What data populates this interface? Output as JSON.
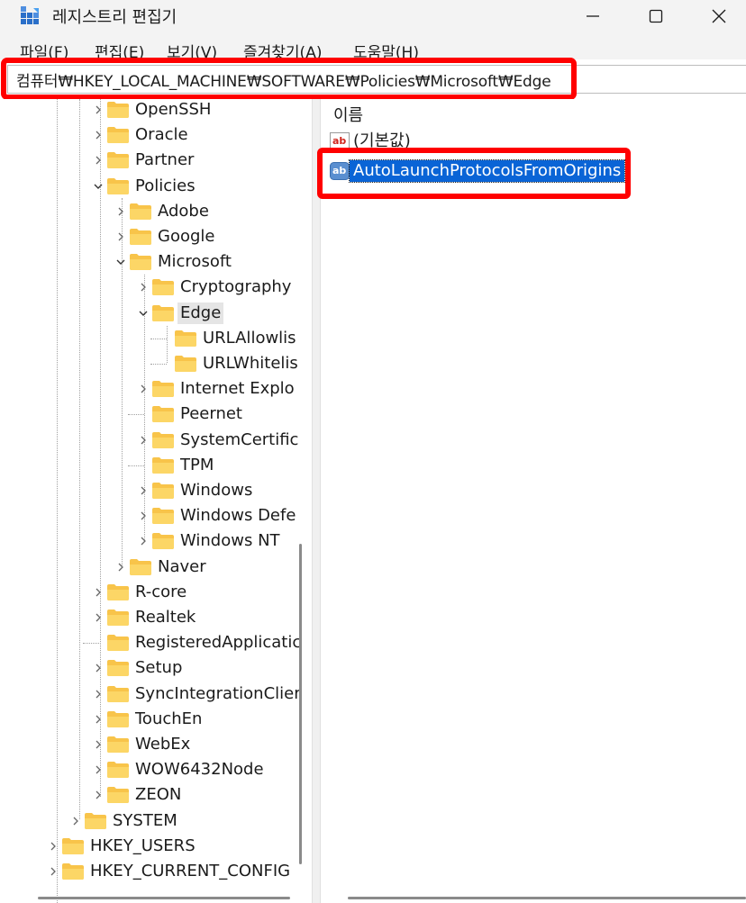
{
  "window": {
    "title": "레지스트리 편집기",
    "icon": "registry-editor-icon",
    "controls": [
      "minimize-icon",
      "maximize-icon",
      "close-icon"
    ]
  },
  "menu": [
    {
      "label": "파일(F)"
    },
    {
      "label": "편집(E)"
    },
    {
      "label": "보기(V)"
    },
    {
      "label": "즐겨찾기(A)"
    },
    {
      "label": "도움말(H)"
    }
  ],
  "address": {
    "value": "컴퓨터₩HKEY_LOCAL_MACHINE₩SOFTWARE₩Policies₩Microsoft₩Edge"
  },
  "tree": [
    {
      "label": "OpenSSH",
      "expander": "collapsed"
    },
    {
      "label": "Oracle",
      "expander": "collapsed"
    },
    {
      "label": "Partner",
      "expander": "collapsed"
    },
    {
      "label": "Policies",
      "expander": "expanded"
    },
    {
      "label": "Adobe",
      "expander": "collapsed"
    },
    {
      "label": "Google",
      "expander": "collapsed"
    },
    {
      "label": "Microsoft",
      "expander": "expanded"
    },
    {
      "label": "Cryptography",
      "expander": "collapsed"
    },
    {
      "label": "Edge",
      "expander": "expanded",
      "selected": true
    },
    {
      "label": "URLAllowlis",
      "expander": "none"
    },
    {
      "label": "URLWhitelis",
      "expander": "none"
    },
    {
      "label": "Internet Explo",
      "expander": "collapsed"
    },
    {
      "label": "Peernet",
      "expander": "none"
    },
    {
      "label": "SystemCertific",
      "expander": "collapsed"
    },
    {
      "label": "TPM",
      "expander": "none"
    },
    {
      "label": "Windows",
      "expander": "collapsed"
    },
    {
      "label": "Windows Defe",
      "expander": "collapsed"
    },
    {
      "label": "Windows NT",
      "expander": "collapsed"
    },
    {
      "label": "Naver",
      "expander": "collapsed"
    },
    {
      "label": "R-core",
      "expander": "collapsed"
    },
    {
      "label": "Realtek",
      "expander": "collapsed"
    },
    {
      "label": "RegisteredApplicatic",
      "expander": "none"
    },
    {
      "label": "Setup",
      "expander": "collapsed"
    },
    {
      "label": "SyncIntegrationClier",
      "expander": "collapsed"
    },
    {
      "label": "TouchEn",
      "expander": "collapsed"
    },
    {
      "label": "WebEx",
      "expander": "collapsed"
    },
    {
      "label": "WOW6432Node",
      "expander": "collapsed"
    },
    {
      "label": "ZEON",
      "expander": "collapsed"
    },
    {
      "label": "SYSTEM",
      "expander": "collapsed"
    },
    {
      "label": "HKEY_USERS",
      "expander": "collapsed"
    },
    {
      "label": "HKEY_CURRENT_CONFIG",
      "expander": "collapsed"
    }
  ],
  "values_pane": {
    "column_name": "이름",
    "values": [
      {
        "name": "(기본값)",
        "icon": "string-value-icon",
        "selected": false
      },
      {
        "name": "AutoLaunchProtocolsFromOrigins",
        "icon": "string-value-icon",
        "selected": true
      }
    ]
  },
  "colors": {
    "highlight_box": "#ff0000",
    "selection": "#0a64d6",
    "folder": "#f8c44a"
  }
}
